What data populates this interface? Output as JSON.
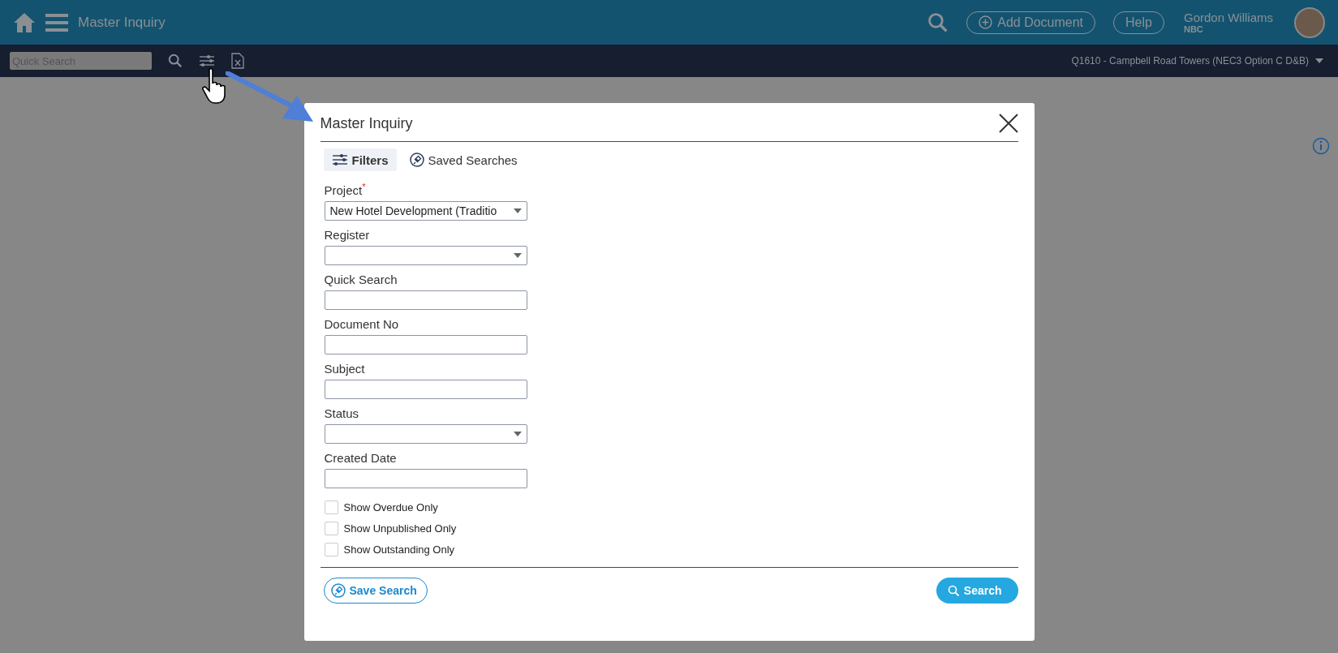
{
  "header": {
    "title": "Master Inquiry",
    "add_button": "Add Document",
    "help_button": "Help",
    "user": {
      "name": "Gordon Williams",
      "org": "NBC"
    }
  },
  "toolbar": {
    "search": {
      "placeholder": "Quick Search"
    },
    "project": "Q1610  -  Campbell Road Towers (NEC3 Option C D&B)"
  },
  "dialog": {
    "title": "Master Inquiry",
    "tabs": [
      {
        "label": "Filters",
        "selected": true,
        "kind": "filters"
      },
      {
        "label": "Saved Searches",
        "selected": false,
        "kind": "saved"
      }
    ],
    "fields": [
      {
        "kind": "select",
        "label": "Project",
        "required": true,
        "value": "New Hotel Development (Traditio"
      },
      {
        "kind": "select",
        "label": "Register",
        "required": false
      },
      {
        "kind": "text",
        "label": "Quick Search",
        "required": false
      },
      {
        "kind": "text",
        "label": "Document No",
        "required": false
      },
      {
        "kind": "text",
        "label": "Subject",
        "required": false
      },
      {
        "kind": "select",
        "label": "Status",
        "required": false
      },
      {
        "kind": "text",
        "label": "Created Date",
        "required": false
      }
    ],
    "checkboxes": [
      {
        "label": "Show Overdue Only",
        "checked": false
      },
      {
        "label": "Show Unpublished Only",
        "checked": false
      },
      {
        "label": "Show Outstanding Only",
        "checked": false
      }
    ],
    "required_mark": "*",
    "save_button": "Save Search",
    "search_button": "Search"
  }
}
